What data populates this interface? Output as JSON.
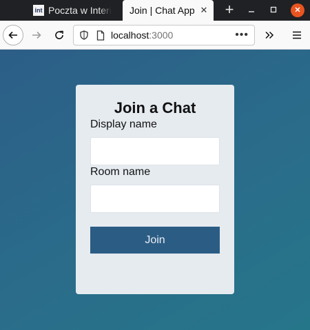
{
  "browser": {
    "tabs": [
      {
        "favicon": "int",
        "title": "Poczta w Interi",
        "active": false
      },
      {
        "title": "Join | Chat App",
        "active": true
      }
    ],
    "url_host": "localhost",
    "url_port": ":3000",
    "icons": {
      "new_tab": "plus-icon",
      "minimize": "minimize-icon",
      "maximize": "maximize-icon",
      "close": "close-icon",
      "back": "arrow-left-icon",
      "forward": "arrow-right-icon",
      "reload": "reload-icon",
      "tracking": "shield-icon",
      "page": "page-icon",
      "page_actions": "ellipsis-icon",
      "overflow": "chevron-double-right-icon",
      "menu": "hamburger-icon"
    }
  },
  "page": {
    "title": "Join a Chat",
    "display_name_label": "Display name",
    "display_name_value": "",
    "room_name_label": "Room name",
    "room_name_value": "",
    "join_label": "Join"
  },
  "colors": {
    "background_start": "#2c5e87",
    "background_end": "#26768a",
    "card": "#e6ebf0",
    "button": "#2b5c84",
    "window_close": "#e95420"
  }
}
